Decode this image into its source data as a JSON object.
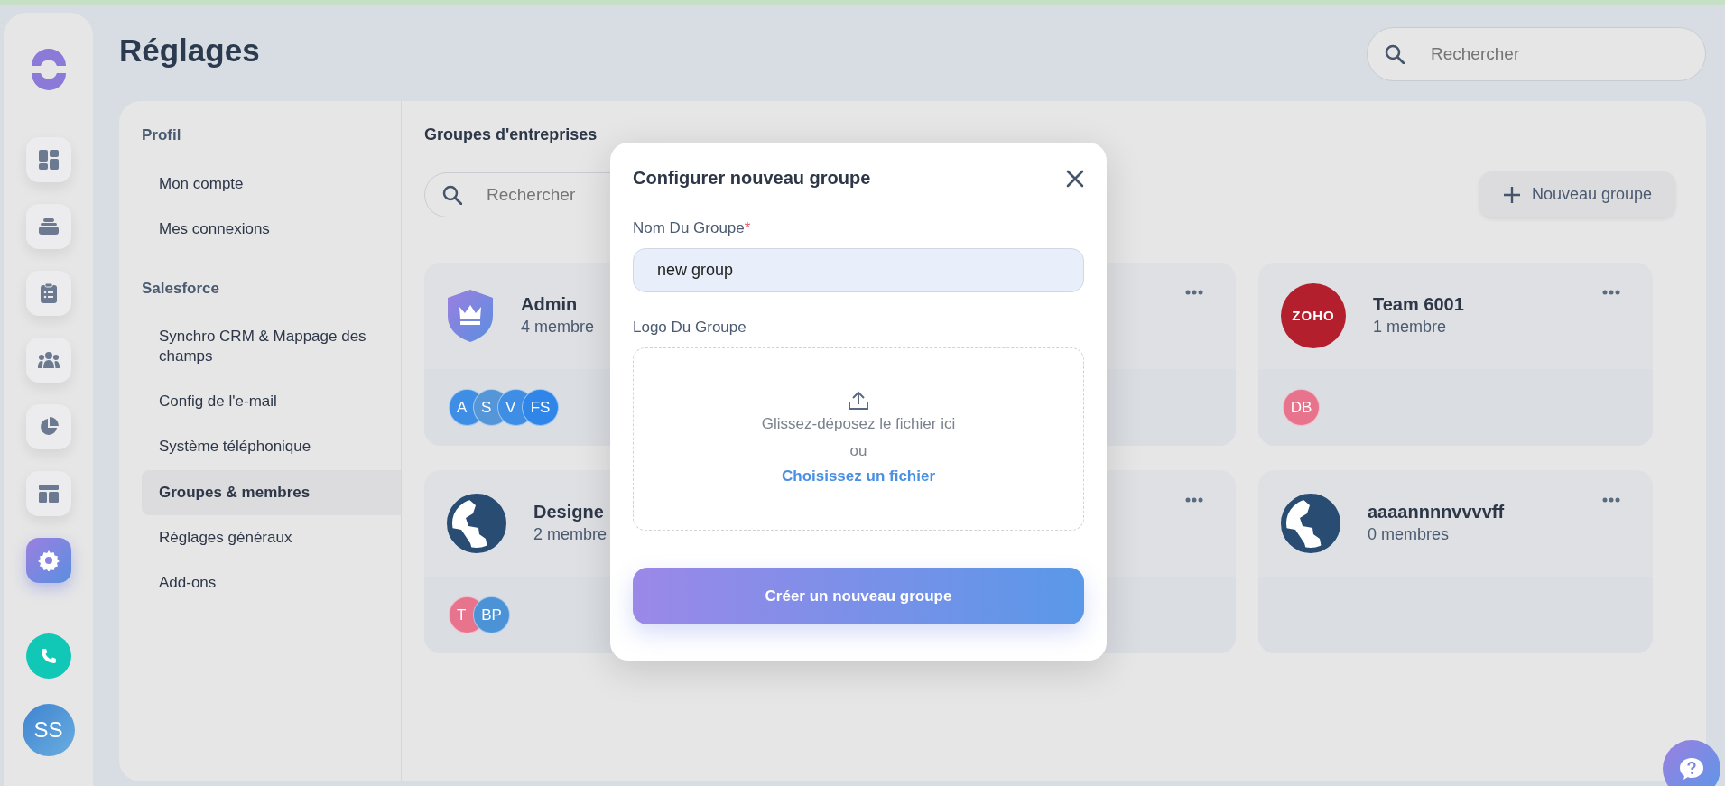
{
  "rail": {
    "items": [
      {
        "selected": false
      },
      {
        "selected": false
      },
      {
        "selected": false
      },
      {
        "selected": false
      },
      {
        "selected": false
      },
      {
        "selected": false
      },
      {
        "selected": true
      }
    ],
    "avatar": "SS"
  },
  "page_title": "Réglages",
  "search": {
    "placeholder": "Rechercher"
  },
  "settings_nav": [
    {
      "title": "Profil",
      "items": [
        {
          "label": "Mon compte",
          "selected": false
        },
        {
          "label": "Mes connexions",
          "selected": false
        }
      ]
    },
    {
      "title": "Salesforce",
      "items": [
        {
          "label": "Synchro CRM & Mappage des champs",
          "selected": false
        },
        {
          "label": "Config de l'e-mail",
          "selected": false
        },
        {
          "label": "Système téléphonique",
          "selected": false
        },
        {
          "label": "Groupes & membres",
          "selected": true
        },
        {
          "label": "Réglages généraux",
          "selected": false
        },
        {
          "label": "Add-ons",
          "selected": false
        }
      ]
    }
  ],
  "content": {
    "title": "Groupes d'entreprises",
    "search": {
      "placeholder": "Rechercher"
    },
    "new_button": "Nouveau groupe",
    "groups": [
      {
        "kind": "shield",
        "name": "Admin",
        "members": "4 membre",
        "avatars": [
          {
            "initials": "A",
            "color": "#3f8ee6"
          },
          {
            "initials": "S",
            "color": "#5596d8"
          },
          {
            "initials": "V",
            "color": "#3f8ee6"
          },
          {
            "initials": "FS",
            "color": "#2f86e8"
          }
        ]
      },
      {
        "kind": "hidden"
      },
      {
        "kind": "zoho",
        "logo_text": "ZOHO",
        "name": "Team 6001",
        "members": "1 membre",
        "avatars": [
          {
            "initials": "DB",
            "color": "#e8738d"
          }
        ]
      },
      {
        "kind": "globe",
        "name": "Designe",
        "members": "2 membre",
        "avatars": [
          {
            "initials": "T",
            "color": "#e8738d"
          },
          {
            "initials": "BP",
            "color": "#4b93d6"
          }
        ]
      },
      {
        "kind": "hidden"
      },
      {
        "kind": "globe",
        "name": "aaaannnnvvvvff",
        "members": "0 membres"
      }
    ]
  },
  "modal": {
    "title": "Configurer nouveau groupe",
    "name_label": "Nom Du Groupe",
    "required_mark": "*",
    "name_value": "new group",
    "logo_label": "Logo Du Groupe",
    "drop_text": "Glissez-déposez le fichier ici",
    "or_text": "ou",
    "choose_link": "Choisissez un fichier",
    "submit": "Créer un nouveau groupe"
  }
}
